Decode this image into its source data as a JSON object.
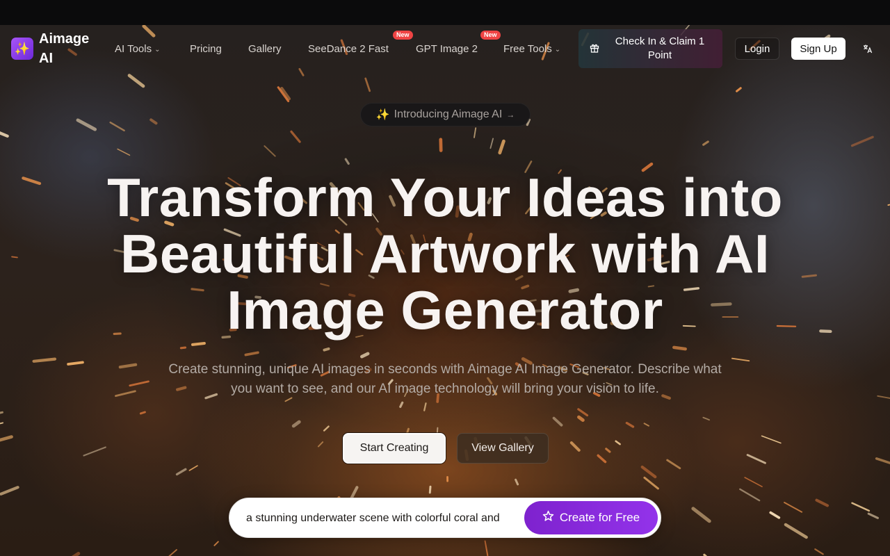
{
  "brand": {
    "name": "Aimage AI",
    "logo_glyph": "✨",
    "accent": "#7e22ce"
  },
  "nav": {
    "items": [
      {
        "label": "AI Tools",
        "has_dropdown": true
      },
      {
        "label": "Pricing"
      },
      {
        "label": "Gallery"
      },
      {
        "label": "SeeDance 2 Fast",
        "badge": "New"
      },
      {
        "label": "GPT Image 2",
        "badge": "New"
      },
      {
        "label": "Free Tools",
        "has_dropdown": true
      }
    ],
    "chevron": "⌄",
    "checkin_label": "Check In & Claim 1 Point",
    "checkin_icon": "gift-icon",
    "login_label": "Login",
    "signup_label": "Sign Up",
    "language_icon": "language-icon"
  },
  "hero": {
    "intro_pill": {
      "spark": "✨",
      "text": "Introducing Aimage AI",
      "arrow": "→"
    },
    "headline": "Transform Your Ideas into Beautiful Artwork with AI Image Generator",
    "subheadline": "Create stunning, unique AI images in seconds with Aimage AI Image Generator. Describe what you want to see, and our AI image technology will bring your vision to life.",
    "start_label": "Start Creating",
    "gallery_label": "View Gallery"
  },
  "prompt": {
    "value": "a stunning underwater scene with colorful coral and",
    "create_label": "Create for Free",
    "create_icon": "sparkle-icon"
  }
}
